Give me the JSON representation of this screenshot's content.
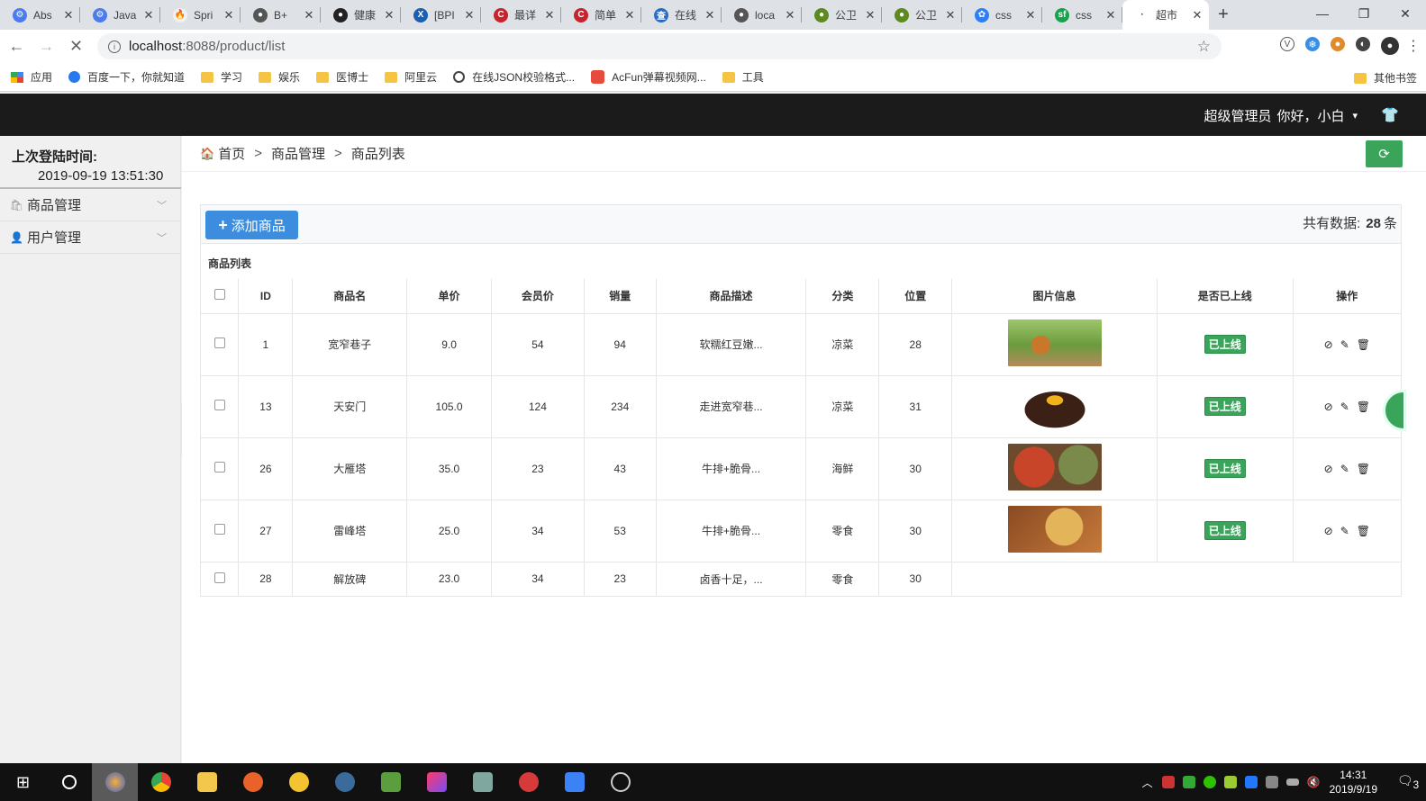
{
  "browser": {
    "tabs": [
      {
        "title": "Abs",
        "color": "#4a7cf0",
        "glyph": "⚙"
      },
      {
        "title": "Java",
        "color": "#4a7cf0",
        "glyph": "⚙"
      },
      {
        "title": "Spri",
        "color": "#f0f0f0",
        "glyph": "🔥"
      },
      {
        "title": "B+",
        "color": "#555555",
        "glyph": "●"
      },
      {
        "title": "健康",
        "color": "#222222",
        "glyph": "●"
      },
      {
        "title": "[BPI",
        "color": "#1a5fb4",
        "glyph": "X"
      },
      {
        "title": "最详",
        "color": "#c8232c",
        "glyph": "C"
      },
      {
        "title": "简单",
        "color": "#c8232c",
        "glyph": "C"
      },
      {
        "title": "在线",
        "color": "#2b6cc4",
        "glyph": "查"
      },
      {
        "title": "loca",
        "color": "#555555",
        "glyph": "●"
      },
      {
        "title": "公卫",
        "color": "#5c8a1e",
        "glyph": "●"
      },
      {
        "title": "公卫",
        "color": "#5c8a1e",
        "glyph": "●"
      },
      {
        "title": "css",
        "color": "#2d7ff9",
        "glyph": "✿"
      },
      {
        "title": "css",
        "color": "#16a34a",
        "glyph": "sf"
      },
      {
        "title": "超市",
        "color": "#ffffff",
        "glyph": "·"
      }
    ],
    "url_host": "localhost",
    "url_path": ":8088/product/list",
    "bookmarks": [
      {
        "label": "应用",
        "kind": "apps"
      },
      {
        "label": "百度一下，你就知道",
        "kind": "paw"
      },
      {
        "label": "学习",
        "kind": "folder"
      },
      {
        "label": "娱乐",
        "kind": "folder"
      },
      {
        "label": "医博士",
        "kind": "folder"
      },
      {
        "label": "阿里云",
        "kind": "folder"
      },
      {
        "label": "在线JSON校验格式...",
        "kind": "globe"
      },
      {
        "label": "AcFun弹幕视频网...",
        "kind": "acfun"
      },
      {
        "label": "工具",
        "kind": "folder"
      }
    ],
    "other_bookmarks": "其他书签"
  },
  "header": {
    "role": "超级管理员",
    "greeting": "你好，小白"
  },
  "sidebar": {
    "last_login_label": "上次登陆时间:",
    "last_login_value": "2019-09-19 13:51:30",
    "items": [
      {
        "label": "商品管理"
      },
      {
        "label": "用户管理"
      }
    ]
  },
  "breadcrumb": [
    "首页",
    "商品管理",
    "商品列表"
  ],
  "panel": {
    "add_button": "添加商品",
    "total_label": "共有数据:",
    "total_count": "28",
    "total_unit": "条",
    "title": "商品列表"
  },
  "table": {
    "columns": [
      "ID",
      "商品名",
      "单价",
      "会员价",
      "销量",
      "商品描述",
      "分类",
      "位置",
      "图片信息",
      "是否已上线",
      "操作"
    ],
    "rows": [
      {
        "id": "1",
        "name": "宽窄巷子",
        "price": "9.0",
        "member_price": "54",
        "sales": "94",
        "desc": "软糯红豆嫩...",
        "category": "凉菜",
        "position": "28",
        "status": "已上线",
        "image": "drink"
      },
      {
        "id": "13",
        "name": "天安门",
        "price": "105.0",
        "member_price": "124",
        "sales": "234",
        "desc": "走进宽窄巷...",
        "category": "凉菜",
        "position": "31",
        "status": "已上线",
        "image": "cake"
      },
      {
        "id": "26",
        "name": "大雁塔",
        "price": "35.0",
        "member_price": "23",
        "sales": "43",
        "desc": "牛排+脆骨...",
        "category": "海鲜",
        "position": "30",
        "status": "已上线",
        "image": "dishes"
      },
      {
        "id": "27",
        "name": "雷峰塔",
        "price": "25.0",
        "member_price": "34",
        "sales": "53",
        "desc": "牛排+脆骨...",
        "category": "零食",
        "position": "30",
        "status": "已上线",
        "image": "pizza"
      },
      {
        "id": "28",
        "name": "解放碑",
        "price": "23.0",
        "member_price": "34",
        "sales": "23",
        "desc": "卤香十足，...",
        "category": "零食",
        "position": "30"
      }
    ]
  },
  "taskbar": {
    "time": "14:31",
    "date": "2019/9/19",
    "notifications": "3"
  },
  "colors": {
    "header_bg": "#1b1b1b",
    "primary_button": "#3c8dde",
    "success": "#3aa55a"
  }
}
